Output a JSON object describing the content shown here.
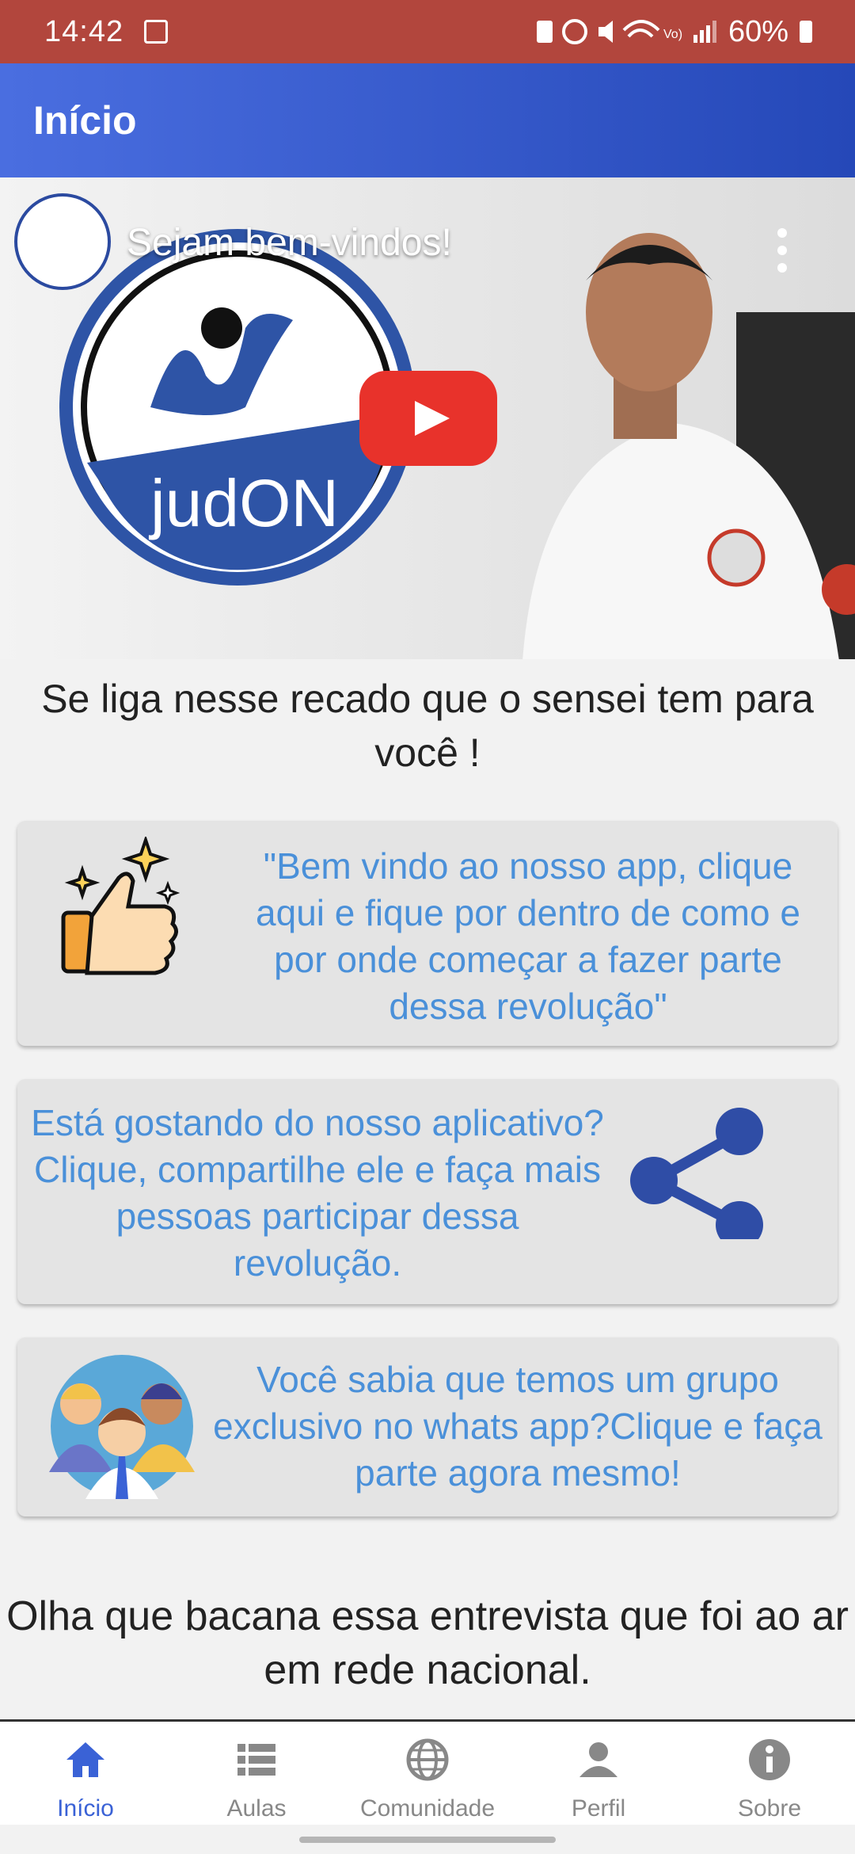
{
  "status_bar": {
    "time": "14:42",
    "battery": "60%"
  },
  "app_bar": {
    "title": "Início"
  },
  "video": {
    "title": "Sejam bem-vindos!",
    "logo_text": "judON"
  },
  "intro_text": "Se liga nesse recado que o sensei tem para você !",
  "cards": {
    "welcome": "\"Bem vindo ao nosso app, clique aqui e fique por dentro de como e por onde começar a fazer parte dessa revolução\"",
    "share": "Está gostando do nosso aplicativo? Clique, compartilhe ele e faça mais pessoas participar dessa revolução.",
    "whatsapp": "Você sabia que temos um grupo exclusivo no whats app?Clique e faça parte agora mesmo!"
  },
  "outro_text": "Olha que bacana essa entrevista que foi ao ar em rede nacional.",
  "bottom_nav": {
    "items": [
      {
        "label": "Início",
        "icon": "home-icon"
      },
      {
        "label": "Aulas",
        "icon": "list-icon"
      },
      {
        "label": "Comunidade",
        "icon": "globe-icon"
      },
      {
        "label": "Perfil",
        "icon": "person-icon"
      },
      {
        "label": "Sobre",
        "icon": "info-icon"
      }
    ]
  },
  "colors": {
    "accent": "#3a62d6",
    "status_bar": "#b2463d",
    "card_text": "#4a90d9"
  }
}
